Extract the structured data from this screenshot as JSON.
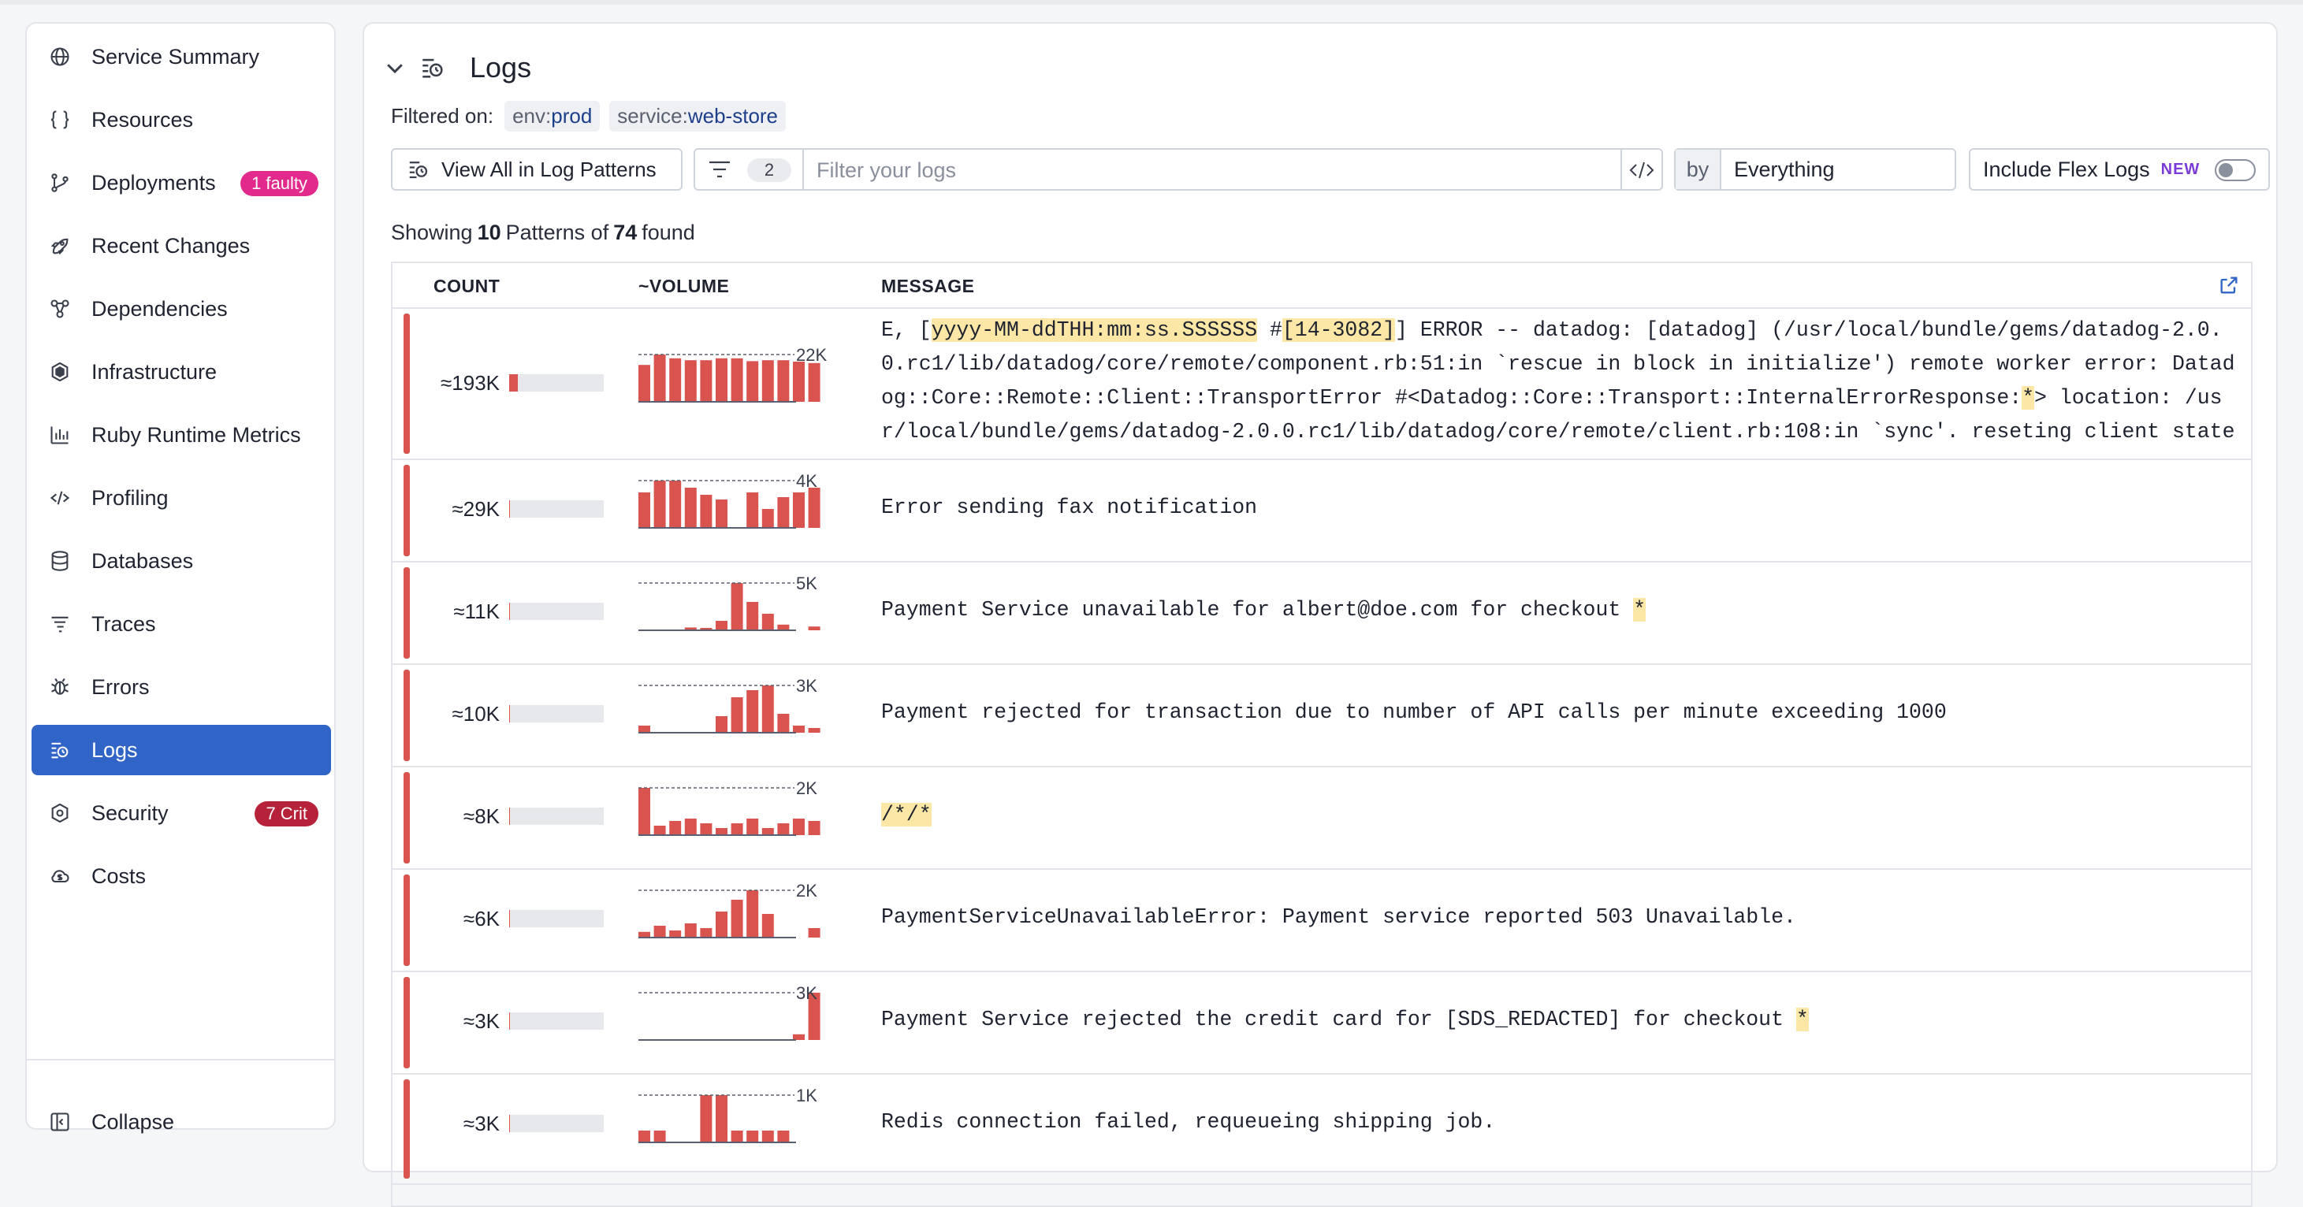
{
  "sidebar": {
    "items": [
      {
        "label": "Service Summary",
        "icon": "globe-icon"
      },
      {
        "label": "Resources",
        "icon": "braces-icon"
      },
      {
        "label": "Deployments",
        "icon": "branch-icon",
        "badge": "1 faulty"
      },
      {
        "label": "Recent Changes",
        "icon": "rocket-icon"
      },
      {
        "label": "Dependencies",
        "icon": "network-icon"
      },
      {
        "label": "Infrastructure",
        "icon": "hexagon-icon"
      },
      {
        "label": "Ruby Runtime Metrics",
        "icon": "bar-chart-icon"
      },
      {
        "label": "Profiling",
        "icon": "code-icon"
      },
      {
        "label": "Databases",
        "icon": "database-icon"
      },
      {
        "label": "Traces",
        "icon": "traces-icon"
      },
      {
        "label": "Errors",
        "icon": "bug-icon"
      },
      {
        "label": "Logs",
        "icon": "logs-icon",
        "active": true
      },
      {
        "label": "Security",
        "icon": "shield-icon",
        "badge": "7 Crit"
      },
      {
        "label": "Costs",
        "icon": "cloud-cost-icon"
      }
    ],
    "collapse_label": "Collapse"
  },
  "header": {
    "title": "Logs"
  },
  "filters": {
    "label": "Filtered on:",
    "chips": [
      {
        "key": "env:",
        "value": "prod"
      },
      {
        "key": "service:",
        "value": "web-store"
      }
    ]
  },
  "toolbar": {
    "patterns_button": "View All in Log Patterns",
    "filter_count": "2",
    "search_placeholder": "Filter your logs",
    "by_label": "by",
    "by_value": "Everything",
    "flex_label": "Include Flex Logs",
    "flex_badge": "NEW"
  },
  "summary": {
    "prefix": "Showing",
    "shown": "10",
    "middle": "Patterns of",
    "total": "74",
    "suffix": "found"
  },
  "table": {
    "columns": {
      "count": "COUNT",
      "volume": "~VOLUME",
      "message": "MESSAGE"
    },
    "colors": {
      "error": "#d9534f"
    },
    "rows": [
      {
        "count": "≈193K",
        "count_fraction": 0.09,
        "volume_max": "22K",
        "volume": [
          0.78,
          1,
          0.92,
          0.88,
          0.88,
          0.92,
          0.92,
          0.86,
          0.88,
          0.88,
          0.85,
          0.82
        ],
        "message_parts": [
          {
            "t": "E, ["
          },
          {
            "t": "yyyy-MM-ddTHH:mm:ss.SSSSSS",
            "hl": true
          },
          {
            "t": " #"
          },
          {
            "t": "[14-3082]",
            "hl": true
          },
          {
            "t": "] ERROR -- datadog: [datadog] (/usr/local/bundle/gems/datadog-2.0.0.rc1/lib/datadog/core/remote/component.rb:51:in `rescue in block in initialize') remote worker error: Datadog::Core::Remote::Client::TransportError #<Datadog::Core::Transport::InternalErrorResponse:"
          },
          {
            "t": "*",
            "hl": true
          },
          {
            "t": "> location: /usr/local/bundle/gems/datadog-2.0.0.rc1/lib/datadog/core/remote/client.rb:108:in `sync'. reseting client state"
          }
        ]
      },
      {
        "count": "≈29K",
        "count_fraction": 0.01,
        "volume_max": "4K",
        "volume": [
          0.75,
          1,
          1,
          0.85,
          0.7,
          0.6,
          0,
          0.75,
          0.4,
          0.65,
          0.75,
          0.85
        ],
        "message_parts": [
          {
            "t": "Error sending fax notification"
          }
        ]
      },
      {
        "count": "≈11K",
        "count_fraction": 0.01,
        "volume_max": "5K",
        "volume": [
          0,
          0,
          0,
          0.06,
          0.05,
          0.2,
          1,
          0.6,
          0.35,
          0.12,
          0,
          0.08
        ],
        "message_parts": [
          {
            "t": "Payment Service unavailable for albert@doe.com for checkout "
          },
          {
            "t": "*",
            "hl": true
          }
        ]
      },
      {
        "count": "≈10K",
        "count_fraction": 0.01,
        "volume_max": "3K",
        "volume": [
          0.15,
          0,
          0,
          0,
          0,
          0.35,
          0.75,
          0.9,
          1,
          0.4,
          0.15,
          0.1
        ],
        "message_parts": [
          {
            "t": "Payment rejected for transaction due to number of API calls per minute exceeding 1000"
          }
        ]
      },
      {
        "count": "≈8K",
        "count_fraction": 0.01,
        "volume_max": "2K",
        "volume": [
          1,
          0.2,
          0.3,
          0.35,
          0.25,
          0.15,
          0.25,
          0.35,
          0.15,
          0.25,
          0.35,
          0.3
        ],
        "message_parts": [
          {
            "t": "/*/*",
            "hl": true
          }
        ]
      },
      {
        "count": "≈6K",
        "count_fraction": 0.01,
        "volume_max": "2K",
        "volume": [
          0.12,
          0.25,
          0.15,
          0.3,
          0.2,
          0.55,
          0.8,
          1,
          0.5,
          0,
          0,
          0.2
        ],
        "message_parts": [
          {
            "t": "PaymentServiceUnavailableError: Payment service reported 503 Unavailable."
          }
        ]
      },
      {
        "count": "≈3K",
        "count_fraction": 0.01,
        "volume_max": "3K",
        "volume": [
          0,
          0,
          0,
          0,
          0,
          0,
          0,
          0,
          0,
          0,
          0.12,
          1
        ],
        "message_parts": [
          {
            "t": "Payment Service rejected the credit card for [SDS_REDACTED] for checkout "
          },
          {
            "t": "*",
            "hl": true
          }
        ]
      },
      {
        "count": "≈3K",
        "count_fraction": 0.01,
        "volume_max": "1K",
        "volume": [
          0.25,
          0.25,
          0,
          0,
          1,
          1,
          0.25,
          0.25,
          0.25,
          0.25,
          0,
          0
        ],
        "message_parts": [
          {
            "t": "Redis connection failed, requeueing shipping job."
          }
        ]
      }
    ]
  }
}
